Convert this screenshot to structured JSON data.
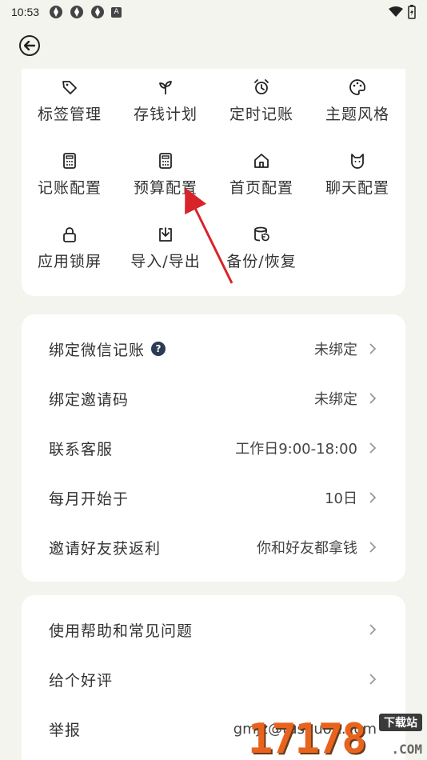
{
  "status_bar": {
    "time": "10:53",
    "notif_letter": "A"
  },
  "grid": [
    {
      "label": "标签管理",
      "icon": "tag-icon"
    },
    {
      "label": "存钱计划",
      "icon": "sprout-icon"
    },
    {
      "label": "定时记账",
      "icon": "alarm-icon"
    },
    {
      "label": "主题风格",
      "icon": "palette-icon"
    },
    {
      "label": "记账配置",
      "icon": "calculator-icon"
    },
    {
      "label": "预算配置",
      "icon": "calculator-icon"
    },
    {
      "label": "首页配置",
      "icon": "home-icon"
    },
    {
      "label": "聊天配置",
      "icon": "cat-icon"
    },
    {
      "label": "应用锁屏",
      "icon": "lock-icon"
    },
    {
      "label": "导入/导出",
      "icon": "import-icon"
    },
    {
      "label": "备份/恢复",
      "icon": "database-restore-icon"
    }
  ],
  "settings": [
    {
      "title": "绑定微信记账",
      "value": "未绑定",
      "help": "?"
    },
    {
      "title": "绑定邀请码",
      "value": "未绑定"
    },
    {
      "title": "联系客服",
      "value": "工作日9:00-18:00"
    },
    {
      "title": "每月开始于",
      "value": "10日"
    },
    {
      "title": "邀请好友获返利",
      "value": "你和好友都拿钱"
    }
  ],
  "help": [
    {
      "title": "使用帮助和常见问题",
      "value": ""
    },
    {
      "title": "给个好评",
      "value": ""
    },
    {
      "title": "举报",
      "value": "gmjz@tushuoit.com"
    }
  ],
  "watermark": {
    "big": "17178",
    "tag": "下载站",
    "com": ".COM"
  },
  "colors": {
    "background": "#f4f4ee",
    "card": "#ffffff",
    "arrow": "#d9232a",
    "help_badge": "#2b3a55"
  }
}
